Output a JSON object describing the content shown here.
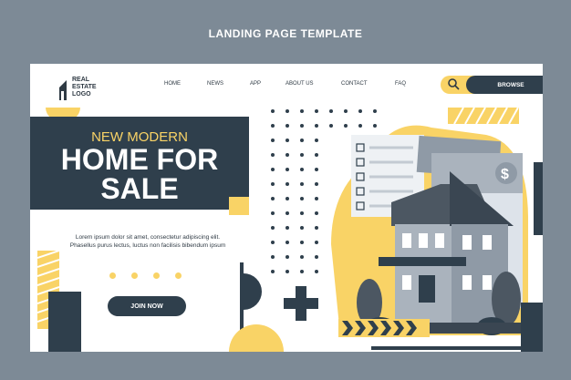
{
  "banner": {
    "title": "LANDING PAGE TEMPLATE"
  },
  "logo": {
    "line1": "REAL",
    "line2": "ESTATE",
    "line3": "LOGO"
  },
  "nav": {
    "items": [
      "HOME",
      "NEWS",
      "APP",
      "ABOUT US",
      "CONTACT",
      "FAQ"
    ]
  },
  "header": {
    "browse_label": "BROWSE"
  },
  "hero": {
    "line1": "NEW MODERN",
    "line2": "HOME FOR",
    "line3": "SALE",
    "description": "Lorem ipsum dolor sit amet, consectetur adipiscing elit. Phasellus purus lectus, luctus non facilisis bibendum ipsum",
    "cta_label": "JOIN NOW"
  },
  "colors": {
    "navy": "#2f3f4c",
    "yellow": "#f9d366",
    "frame": "#7d8a96",
    "white": "#ffffff"
  },
  "icons": {
    "search": "search-icon",
    "dollar": "dollar-icon",
    "checkbox": "checkbox-icon",
    "house": "house-illustration"
  }
}
